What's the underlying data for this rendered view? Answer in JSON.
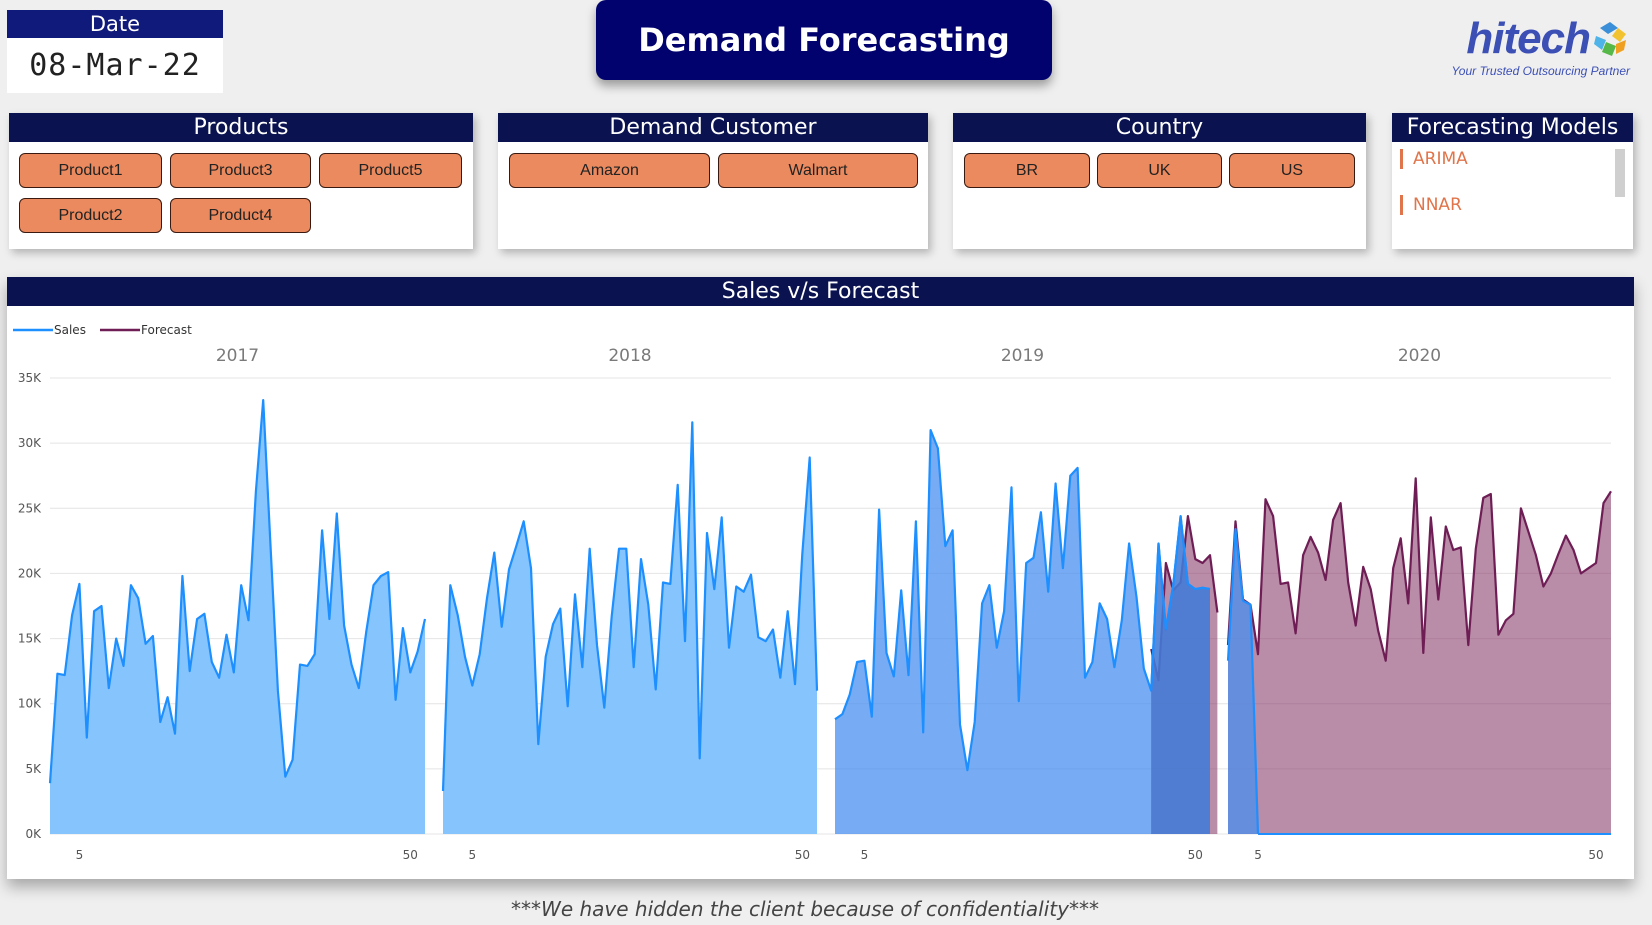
{
  "date": {
    "label": "Date",
    "value": "08-Mar-22"
  },
  "title": "Demand Forecasting",
  "logo": {
    "word": "hitech",
    "tagline": "Your Trusted Outsourcing Partner"
  },
  "products": {
    "label": "Products",
    "items": [
      "Product1",
      "Product3",
      "Product5",
      "Product2",
      "Product4"
    ]
  },
  "customer": {
    "label": "Demand Customer",
    "items": [
      "Amazon",
      "Walmart"
    ]
  },
  "country": {
    "label": "Country",
    "items": [
      "BR",
      "UK",
      "US"
    ]
  },
  "models": {
    "label": "Forecasting Models",
    "items": [
      "ARIMA",
      "NNAR"
    ],
    "accent": "#e0744a"
  },
  "footnote": "***We have hidden the client because of confidentiality***",
  "chart_data": {
    "type": "area",
    "title": "Sales v/s Forecast",
    "legend": [
      {
        "name": "Sales",
        "color": "#1e8fff"
      },
      {
        "name": "Forecast",
        "color": "#6e1e55"
      }
    ],
    "legend_position": "top-left",
    "ylim": [
      0,
      35000
    ],
    "yticks": [
      "0K",
      "5K",
      "10K",
      "15K",
      "20K",
      "25K",
      "30K",
      "35K"
    ],
    "ytick_values": [
      0,
      5000,
      10000,
      15000,
      20000,
      25000,
      30000,
      35000
    ],
    "grid": true,
    "panels": [
      "2017",
      "2018",
      "2019",
      "2020"
    ],
    "xticks": [
      "5",
      "50"
    ],
    "xtick_values": [
      5,
      50
    ],
    "series": [
      {
        "name": "Sales",
        "year": "2017",
        "start_week": 1,
        "values": [
          3900,
          12300,
          12200,
          16800,
          19200,
          7400,
          17100,
          17500,
          11200,
          15000,
          12900,
          19100,
          18100,
          14600,
          15200,
          8600,
          10500,
          7700,
          19800,
          12500,
          16500,
          16900,
          13200,
          12000,
          15300,
          12400,
          19100,
          16400,
          26300,
          33300,
          22000,
          11000,
          4400,
          5700,
          13000,
          12900,
          13800,
          23300,
          16500,
          24600,
          16000,
          13000,
          11200,
          15500,
          19100,
          19800,
          20100,
          10300,
          15800,
          12400,
          14000,
          16500
        ]
      },
      {
        "name": "Sales",
        "year": "2018",
        "start_week": 1,
        "values": [
          3300,
          19100,
          16800,
          13600,
          11400,
          13800,
          18100,
          21600,
          15900,
          20300,
          22100,
          24000,
          20400,
          6900,
          13600,
          16100,
          17300,
          9800,
          18400,
          12800,
          21900,
          14500,
          9700,
          16700,
          21900,
          21900,
          12800,
          21100,
          17600,
          11100,
          19300,
          19200,
          26800,
          14800,
          31600,
          5800,
          23100,
          18800,
          24300,
          14300,
          19000,
          18600,
          19900,
          15100,
          14800,
          15700,
          12000,
          17100,
          11500,
          21500,
          28900,
          11000
        ]
      },
      {
        "name": "Sales",
        "year": "2019",
        "start_week": 1,
        "values": [
          8800,
          9200,
          10700,
          13200,
          13300,
          9000,
          24900,
          13900,
          12100,
          18700,
          12200,
          24000,
          7800,
          31000,
          29600,
          22100,
          23300,
          8400,
          4900,
          8600,
          17700,
          19100,
          14300,
          17100,
          26600,
          10200,
          20800,
          21200,
          24700,
          18600,
          26900,
          20400,
          27500,
          28100,
          12000,
          13200,
          17700,
          16500,
          12800,
          16400,
          22300,
          18200,
          12700,
          11000,
          22300,
          15700,
          19100,
          24400,
          19200,
          18800,
          18900,
          18800
        ],
        "overlap_start_week": 44
      },
      {
        "name": "Forecast",
        "year": "2019",
        "start_week": 44,
        "values": [
          14200,
          11800,
          20800,
          18700,
          19300,
          24400,
          21100,
          20800,
          21400,
          17000
        ]
      },
      {
        "name": "Sales",
        "year": "2020",
        "start_week": 1,
        "values": [
          13300,
          23400,
          17900,
          17600,
          0
        ],
        "overlap_start_week": 1
      },
      {
        "name": "Forecast",
        "year": "2020",
        "start_week": 1,
        "values": [
          14500,
          24000,
          18000,
          17600,
          13800,
          25700,
          24400,
          19200,
          19300,
          15400,
          21400,
          22800,
          21600,
          19500,
          24100,
          25400,
          19300,
          16000,
          20500,
          18800,
          15600,
          13300,
          20400,
          22700,
          17700,
          27300,
          13900,
          24300,
          18000,
          23600,
          21800,
          22000,
          14500,
          21900,
          25800,
          26100,
          15300,
          16400,
          16900,
          25000,
          23200,
          21400,
          19000,
          20000,
          21500,
          22900,
          21800,
          20000,
          20400,
          20800,
          25400,
          26300
        ]
      }
    ]
  }
}
